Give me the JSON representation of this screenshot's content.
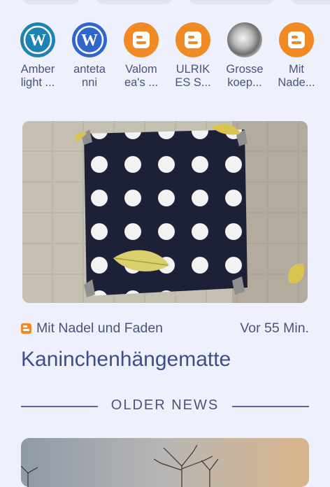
{
  "feeds": [
    {
      "label": "Amber\nlight ...",
      "icon": "wordpress-icon",
      "color": "#1e83b3"
    },
    {
      "label": "anteta\nnni",
      "icon": "wordpress-icon",
      "color": "#2f66ce"
    },
    {
      "label": "Valom\nea's ...",
      "icon": "blogger-icon",
      "color": "#f08a24"
    },
    {
      "label": "ULRIK\nES S...",
      "icon": "blogger-icon",
      "color": "#f08a24"
    },
    {
      "label": "Grosse\nkoep...",
      "icon": "photo-avatar-icon",
      "color": "#8f8f8f"
    },
    {
      "label": "Mit\nNade...",
      "icon": "blogger-icon",
      "color": "#f08a24"
    }
  ],
  "article": {
    "source": "Mit Nadel und Faden",
    "source_icon": "blogger-icon",
    "time_ago": "Vor 55 Min.",
    "title": "Kaninchenhängematte"
  },
  "section": {
    "older_label": "OLDER NEWS"
  },
  "colors": {
    "background": "#eef0fc",
    "headline": "#3d4f86",
    "blogger": "#f08a24"
  }
}
